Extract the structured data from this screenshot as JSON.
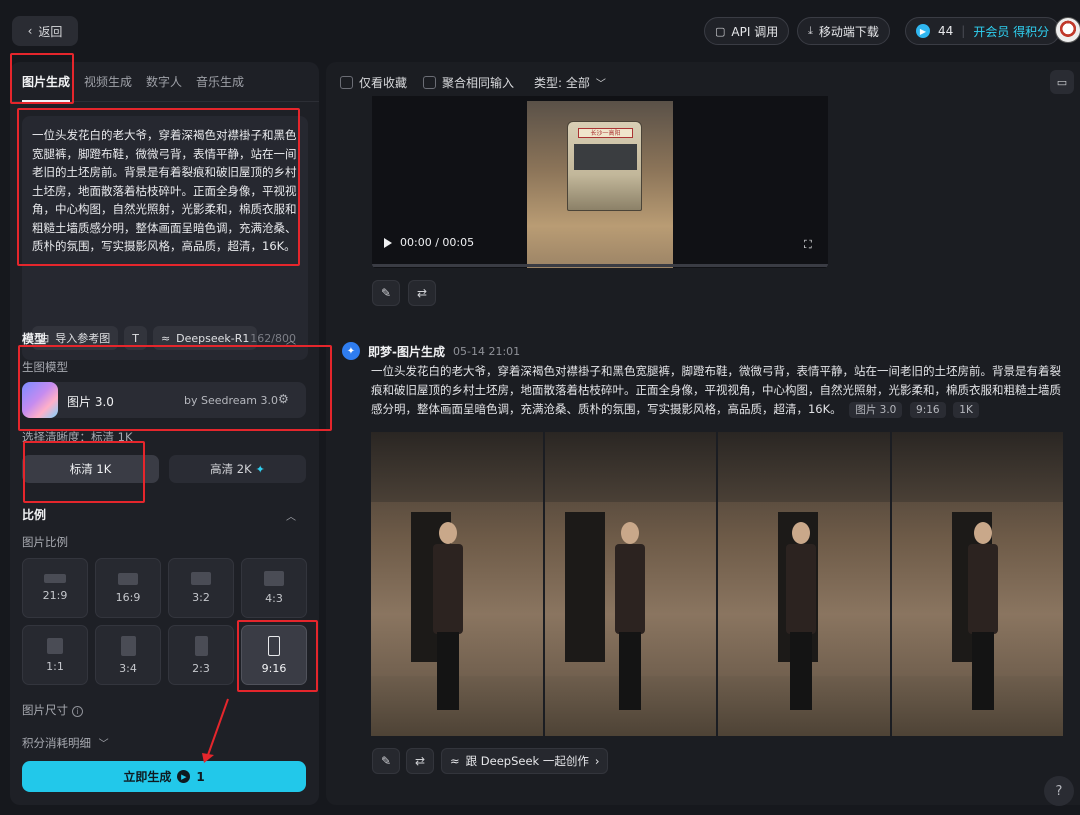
{
  "topbar": {
    "back_label": "返回",
    "api_label": "API 调用",
    "download_label": "移动端下载",
    "credits": "44",
    "vip_label": "开会员 得积分"
  },
  "left": {
    "tabs": [
      {
        "label": "图片生成",
        "active": true
      },
      {
        "label": "视频生成",
        "active": false
      },
      {
        "label": "数字人",
        "active": false
      },
      {
        "label": "音乐生成",
        "active": false
      }
    ],
    "prompt": "一位头发花白的老大爷，穿着深褐色对襟褂子和黑色宽腿裤，脚蹬布鞋，微微弓背，表情平静，站在一间老旧的土坯房前。背景是有着裂痕和破旧屋顶的乡村土坯房，地面散落着枯枝碎叶。正面全身像，平视视角，中心构图，自然光照射，光影柔和，棉质衣服和粗糙土墙质感分明，整体画面呈暗色调，充满沧桑、质朴的氛围，写实摄影风格，高品质，超清，16K。",
    "tools": {
      "import_ref": "导入参考图",
      "deepseek": "Deepseek-R1",
      "count": "162/800"
    },
    "model_section": "模型",
    "model_sub": "生图模型",
    "model": {
      "name": "图片 3.0",
      "by": "by Seedream 3.0"
    },
    "resolution_hint": "选择清晰度：标清 1K",
    "resolutions": [
      {
        "label": "标清 1K",
        "selected": true
      },
      {
        "label": "高清 2K",
        "selected": false
      }
    ],
    "ratio_section": "比例",
    "ratio_sub": "图片比例",
    "ratios": [
      {
        "label": "21:9",
        "selected": false
      },
      {
        "label": "16:9",
        "selected": false
      },
      {
        "label": "3:2",
        "selected": false
      },
      {
        "label": "4:3",
        "selected": false
      },
      {
        "label": "1:1",
        "selected": false
      },
      {
        "label": "3:4",
        "selected": false
      },
      {
        "label": "2:3",
        "selected": false
      },
      {
        "label": "9:16",
        "selected": true
      }
    ],
    "size_label": "图片尺寸",
    "cost_label": "积分消耗明细",
    "generate_label": "立即生成",
    "generate_cost": "1"
  },
  "right": {
    "filters": {
      "favorites": "仅看收藏",
      "aggregate": "聚合相同输入",
      "type_label": "类型: 全部"
    },
    "video": {
      "time": "00:00 / 00:05",
      "bus_sign": "长沙一高阳"
    },
    "generation": {
      "title": "即梦-图片生成",
      "time": "05-14  21:01",
      "prompt": "一位头发花白的老大爷，穿着深褐色对襟褂子和黑色宽腿裤，脚蹬布鞋，微微弓背，表情平静，站在一间老旧的土坯房前。背景是有着裂痕和破旧屋顶的乡村土坯房，地面散落着枯枝碎叶。正面全身像，平视视角，中心构图，自然光照射，光影柔和，棉质衣服和粗糙土墙质感分明，整体画面呈暗色调，充满沧桑、质朴的氛围，写实摄影风格，高品质，超清，16K。",
      "tags": [
        "图片 3.0",
        "9:16",
        "1K"
      ]
    },
    "deepseek_label": "跟 DeepSeek 一起创作",
    "help": "?"
  },
  "colors": {
    "accent": "#22c8ea",
    "annotation": "#e5262c",
    "background": "#16181d"
  }
}
